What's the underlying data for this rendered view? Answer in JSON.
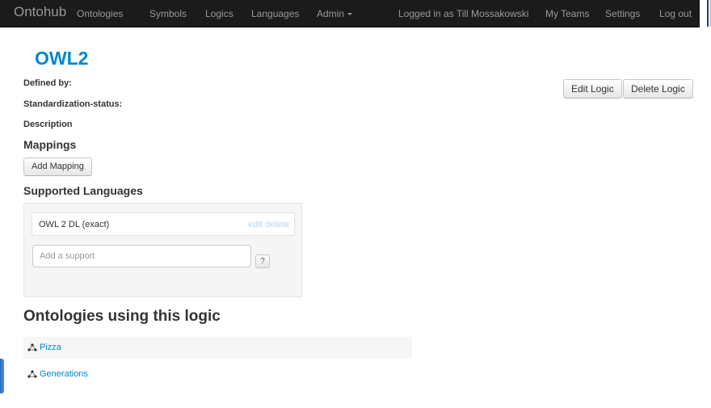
{
  "navbar": {
    "brand": "Ontohub",
    "items": [
      "Ontologies",
      "Symbols",
      "Logics",
      "Languages",
      "Admin"
    ],
    "user_text": "Logged in as Till Mossakowski",
    "right_items": [
      "My Teams",
      "Settings",
      "Log out"
    ]
  },
  "page": {
    "title": "OWL2",
    "labels": {
      "defined_by": "Defined by:",
      "standardization": "Standardization-status:",
      "description": "Description"
    },
    "actions": {
      "edit": "Edit Logic",
      "delete": "Delete Logic"
    }
  },
  "mappings": {
    "heading": "Mappings",
    "add_button": "Add Mapping"
  },
  "supported_languages": {
    "heading": "Supported Languages",
    "items": [
      {
        "name": "OWL 2 DL (exact)",
        "edit": "edit",
        "delete": "delete"
      }
    ],
    "input_placeholder": "Add a support",
    "help_label": "?"
  },
  "ontologies": {
    "heading": "Ontologies using this logic",
    "items": [
      "Pizza",
      "Generations"
    ]
  },
  "colors": {
    "navbar": "#1b1b1b",
    "link": "#0088cc",
    "well": "#f5f5f5"
  },
  "icons": [
    "caret-down-icon",
    "ontology-icon"
  ]
}
